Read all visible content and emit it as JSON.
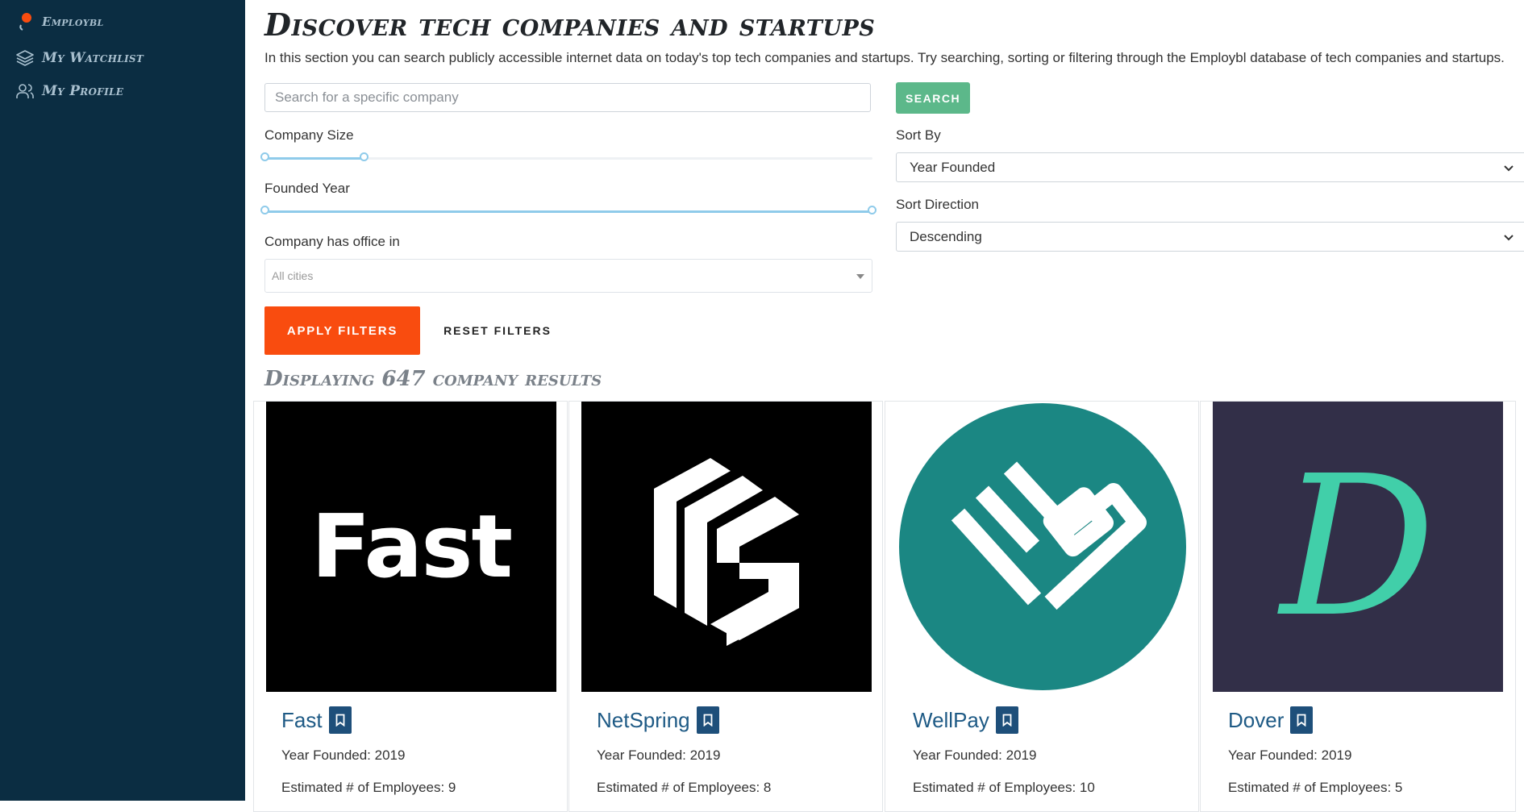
{
  "sidebar": {
    "brand": "Employbl",
    "items": [
      {
        "label": "My Watchlist",
        "icon": "layers-icon"
      },
      {
        "label": "My Profile",
        "icon": "users-icon"
      }
    ]
  },
  "header": {
    "title": "Discover tech companies and startups",
    "intro": "In this section you can search publicly accessible internet data on today's top tech companies and startups. Try searching, sorting or filtering through the Employbl database of tech companies and startups."
  },
  "search": {
    "placeholder": "Search for a specific company",
    "button": "SEARCH"
  },
  "filters": {
    "company_size_label": "Company Size",
    "company_size_range": [
      0,
      0.165
    ],
    "founded_year_label": "Founded Year",
    "founded_year_range": [
      0,
      1
    ],
    "office_label": "Company has office in",
    "office_placeholder": "All cities",
    "apply": "APPLY FILTERS",
    "reset": "RESET FILTERS"
  },
  "sort": {
    "by_label": "Sort By",
    "by_value": "Year Founded",
    "direction_label": "Sort Direction",
    "direction_value": "Descending"
  },
  "results": {
    "heading": "Displaying 647 company results",
    "companies": [
      {
        "name": "Fast",
        "year": "Year Founded: 2019",
        "employees": "Estimated # of Employees: 9",
        "logo_text": "Fast"
      },
      {
        "name": "NetSpring",
        "year": "Year Founded: 2019",
        "employees": "Estimated # of Employees: 8"
      },
      {
        "name": "WellPay",
        "year": "Year Founded: 2019",
        "employees": "Estimated # of Employees: 10"
      },
      {
        "name": "Dover",
        "year": "Year Founded: 2019",
        "employees": "Estimated # of Employees: 5",
        "logo_text": "D"
      }
    ]
  },
  "colors": {
    "sidebar_bg": "#0b2d42",
    "accent_orange": "#f94c0f",
    "search_green": "#5cb88a",
    "link_blue": "#1e5a85",
    "slider_blue": "#8fcbea"
  }
}
